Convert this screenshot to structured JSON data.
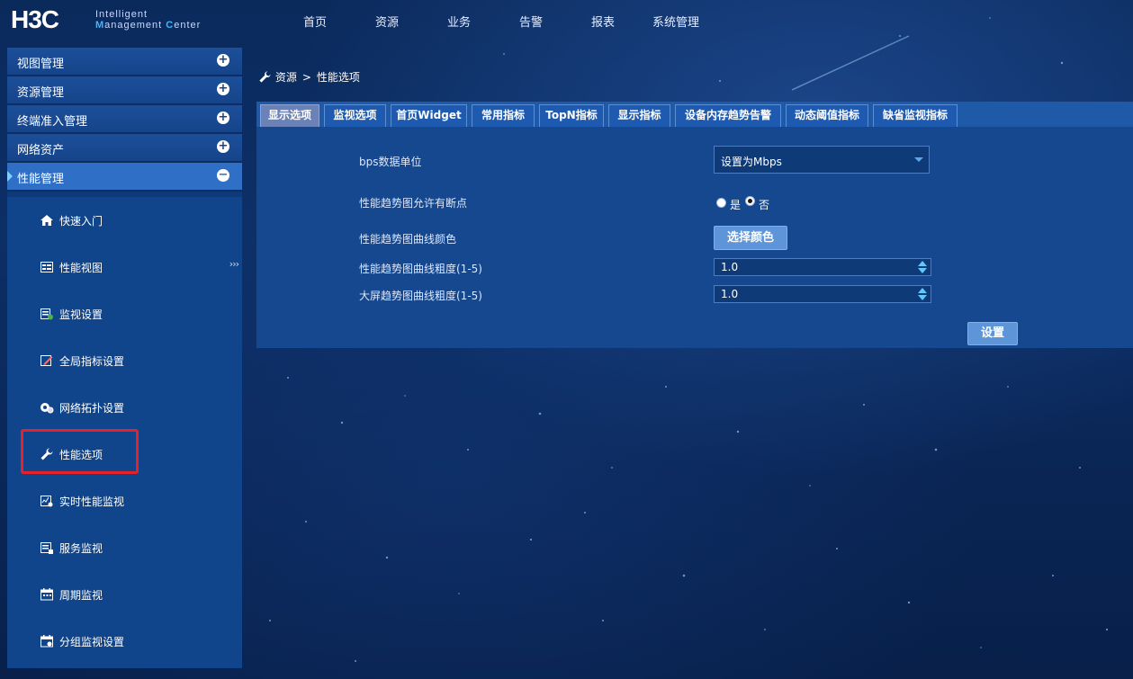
{
  "app": {
    "logo_main": "H3C",
    "logo_line1": "Intelligent",
    "logo_line2_a": "M",
    "logo_line2_b": "anagement ",
    "logo_line2_c": "C",
    "logo_line2_d": "enter"
  },
  "nav": [
    "首页",
    "资源",
    "业务",
    "告警",
    "报表",
    "系统管理"
  ],
  "sidebar": {
    "sections": [
      {
        "label": "视图管理",
        "toggle": "+"
      },
      {
        "label": "资源管理",
        "toggle": "+"
      },
      {
        "label": "终端准入管理",
        "toggle": "+"
      },
      {
        "label": "网络资产",
        "toggle": "+"
      },
      {
        "label": "性能管理",
        "toggle": "−"
      }
    ],
    "items": [
      {
        "label": "快速入门",
        "icon": "home-icon"
      },
      {
        "label": "性能视图",
        "icon": "view-icon"
      },
      {
        "label": "监视设置",
        "icon": "monitor-settings-icon"
      },
      {
        "label": "全局指标设置",
        "icon": "edit-icon"
      },
      {
        "label": "网络拓扑设置",
        "icon": "topology-icon"
      },
      {
        "label": "性能选项",
        "icon": "wrench-icon"
      },
      {
        "label": "实时性能监视",
        "icon": "realtime-icon"
      },
      {
        "label": "服务监视",
        "icon": "service-icon"
      },
      {
        "label": "周期监视",
        "icon": "calendar-icon"
      },
      {
        "label": "分组监视设置",
        "icon": "group-calendar-icon"
      }
    ],
    "expand_arrows": "›››"
  },
  "breadcrumb": {
    "root": "资源",
    "sep": ">",
    "current": "性能选项"
  },
  "tabs": [
    "显示选项",
    "监视选项",
    "首页Widget",
    "常用指标",
    "TopN指标",
    "显示指标",
    "设备内存趋势告警",
    "动态阈值指标",
    "缺省监视指标"
  ],
  "form": {
    "bps_label": "bps数据单位",
    "bps_value": "设置为Mbps",
    "break_label": "性能趋势图允许有断点",
    "radio_yes": "是",
    "radio_no": "否",
    "radio_selected": "否",
    "color_label": "性能趋势图曲线颜色",
    "color_button": "选择颜色",
    "width_label": "性能趋势图曲线粗度(1-5)",
    "width_value": "1.0",
    "bigscreen_label": "大屏趋势图曲线粗度(1-5)",
    "bigscreen_value": "1.0",
    "submit": "设置"
  },
  "colors": {
    "highlight": "#e8202a",
    "accent": "#3fb5ff",
    "active_tab": "#6b82b8"
  }
}
